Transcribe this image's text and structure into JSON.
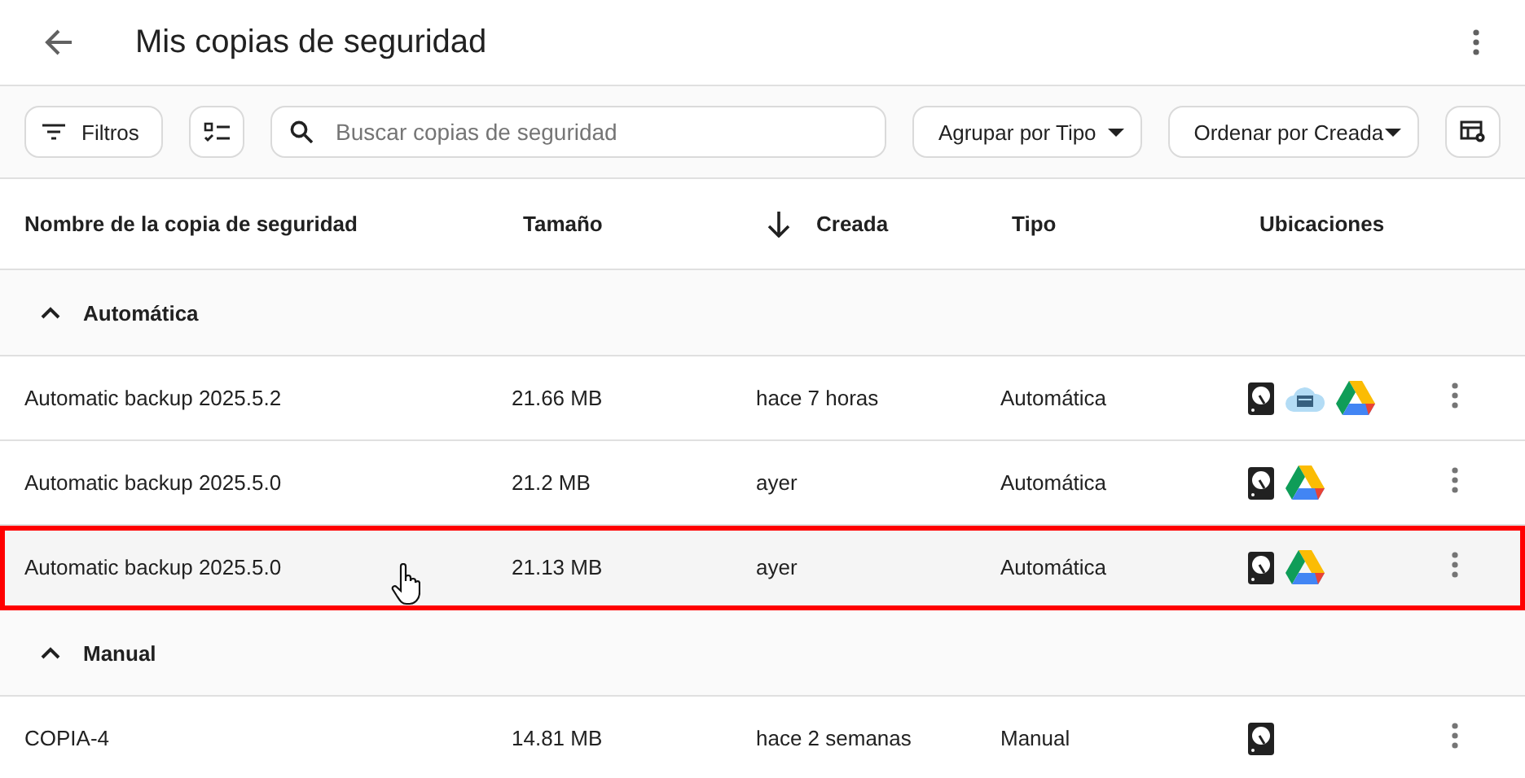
{
  "header": {
    "title": "Mis copias de seguridad"
  },
  "toolbar": {
    "filter_button": "Filtros",
    "search": {
      "placeholder": "Buscar copias de seguridad"
    },
    "group_select": "Agrupar por Tipo",
    "sort_select": "Ordenar por Creada"
  },
  "table": {
    "columns": [
      {
        "label": "Nombre de la copia de seguridad",
        "sorted": false
      },
      {
        "label": "Tamaño",
        "sorted": false
      },
      {
        "label": "Creada",
        "sorted": true
      },
      {
        "label": "Tipo",
        "sorted": false
      },
      {
        "label": "Ubicaciones",
        "sorted": false
      }
    ],
    "groups": [
      {
        "label": "Automática",
        "expanded": true,
        "rows": [
          {
            "name": "Automatic backup 2025.5.2",
            "size": "21.66 MB",
            "created": "hace 7 horas",
            "type": "Automática",
            "highlighted": false,
            "locations": [
              {
                "kind": "disk"
              },
              {
                "kind": "cloud"
              },
              {
                "kind": "drive"
              }
            ]
          },
          {
            "name": "Automatic backup 2025.5.0",
            "size": "21.2 MB",
            "created": "ayer",
            "type": "Automática",
            "highlighted": false,
            "locations": [
              {
                "kind": "disk"
              },
              {
                "kind": "drive"
              }
            ]
          },
          {
            "name": "Automatic backup 2025.5.0",
            "size": "21.13 MB",
            "created": "ayer",
            "type": "Automática",
            "highlighted": true,
            "locations": [
              {
                "kind": "disk"
              },
              {
                "kind": "drive"
              }
            ]
          }
        ]
      },
      {
        "label": "Manual",
        "expanded": true,
        "rows": [
          {
            "name": "COPIA-4",
            "size": "14.81 MB",
            "created": "hace 2 semanas",
            "type": "Manual",
            "highlighted": false,
            "locations": [
              {
                "kind": "disk"
              }
            ]
          }
        ]
      }
    ]
  }
}
